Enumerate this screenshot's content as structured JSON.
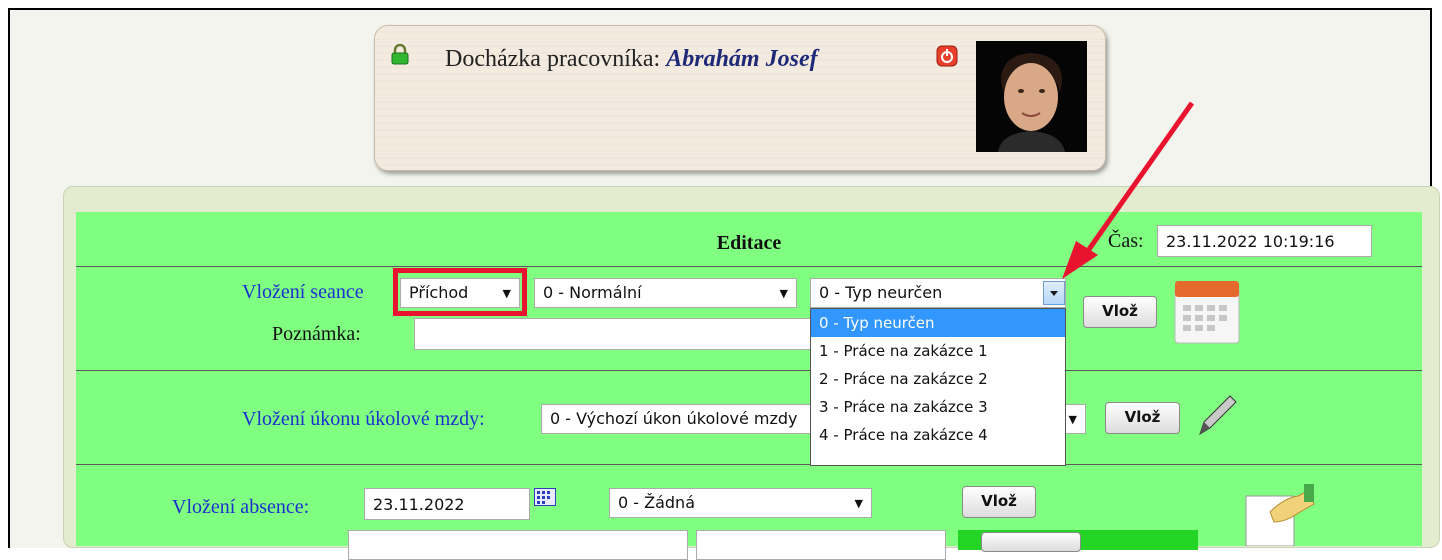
{
  "header": {
    "label": "Docházka pracovníka:",
    "worker_name": "Abrahám Josef"
  },
  "panel": {
    "title": "Editace",
    "time_label": "Čas:",
    "time_value": "23.11.2022 10:19:16"
  },
  "session": {
    "label": "Vložení seance",
    "type_value": "Příchod",
    "mode_value": "0 - Normální",
    "category_value": "0 - Typ neurčen",
    "note_label": "Poznámka:",
    "note_value": "",
    "submit_label": "Vlož",
    "dropdown_options": [
      "0 - Typ neurčen",
      "1 - Práce na zakázce 1",
      "2 - Práce na zakázce 2",
      "3 - Práce na zakázce 3",
      "4 - Práce na zakázce 4"
    ]
  },
  "piecework": {
    "label": "Vložení úkonu úkolové mzdy:",
    "value": "0 - Výchozí úkon úkolové mzdy",
    "submit_label": "Vlož"
  },
  "absence": {
    "label": "Vložení absence:",
    "date_value": "23.11.2022",
    "type_value": "0 - Žádná",
    "submit_label": "Vlož"
  },
  "colors": {
    "panel_green": "#80ff80",
    "highlight_red": "#e8132f",
    "label_blue": "#1a2fd0",
    "selected_option": "#3296ff"
  },
  "icons": [
    "lock-icon",
    "power-icon",
    "calendar-icon",
    "pen-icon",
    "date-picker-icon",
    "document-hand-icon",
    "dropdown-arrow-icon"
  ]
}
